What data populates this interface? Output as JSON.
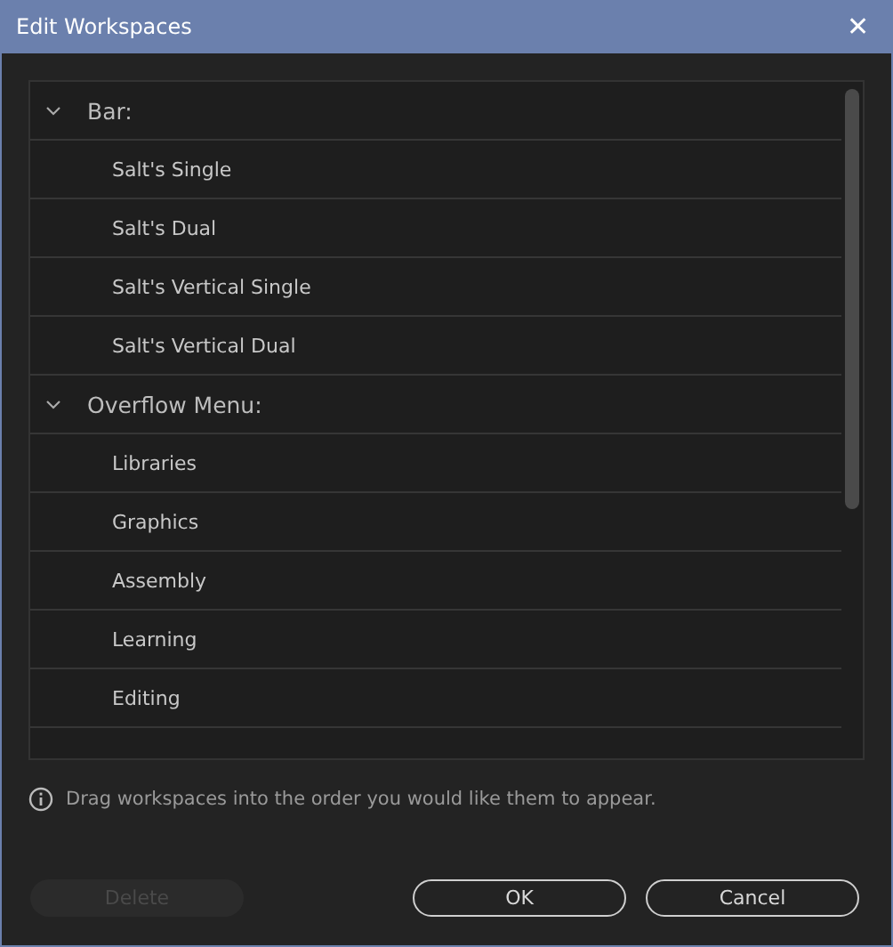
{
  "window": {
    "title": "Edit Workspaces",
    "close": "✕"
  },
  "tree": [
    {
      "label": "Bar:",
      "expanded": true,
      "children": [
        {
          "label": "Salt's Single"
        },
        {
          "label": "Salt's Dual"
        },
        {
          "label": "Salt's Vertical Single"
        },
        {
          "label": "Salt's Vertical Dual"
        }
      ]
    },
    {
      "label": "Overflow Menu:",
      "expanded": true,
      "children": [
        {
          "label": "Libraries"
        },
        {
          "label": "Graphics"
        },
        {
          "label": "Assembly"
        },
        {
          "label": "Learning"
        },
        {
          "label": "Editing"
        }
      ]
    }
  ],
  "hint": "Drag workspaces into the order you would like them to appear.",
  "buttons": [
    {
      "label": "Delete",
      "disabled": true,
      "kind": "plain"
    },
    {
      "label": "OK",
      "disabled": false,
      "kind": "outline"
    },
    {
      "label": "Cancel",
      "disabled": false,
      "kind": "outline"
    }
  ]
}
